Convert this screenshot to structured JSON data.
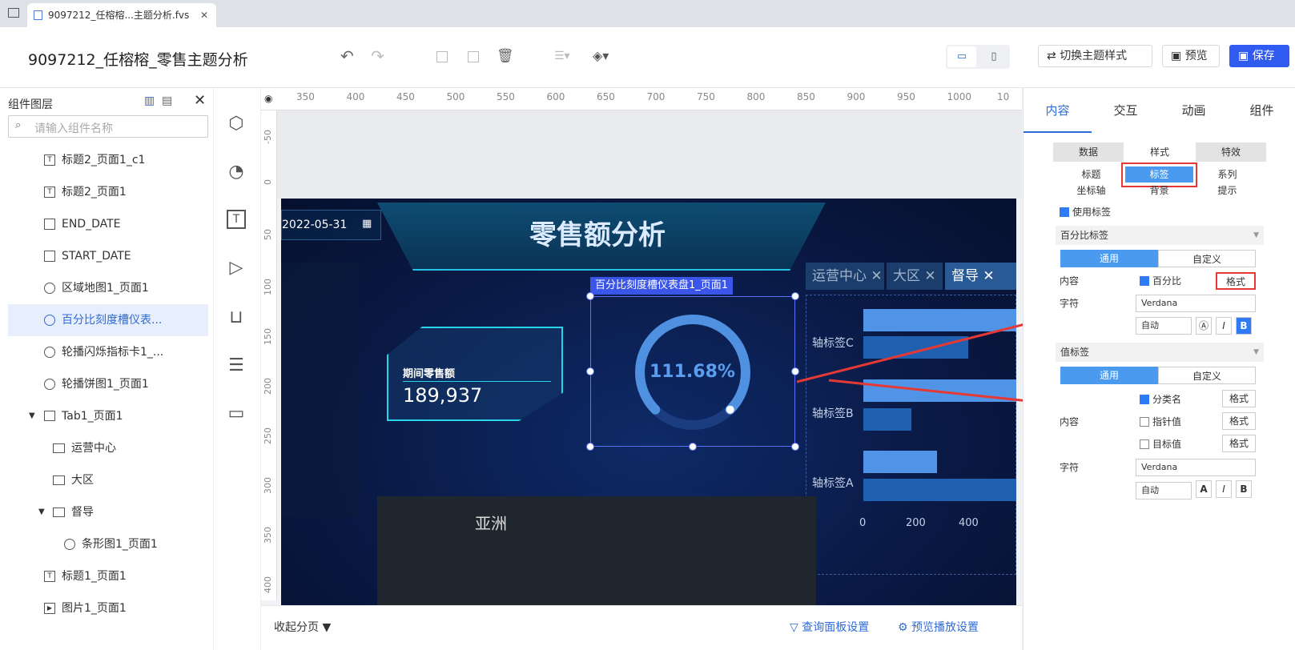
{
  "browser_tab": {
    "title": "9097212_任榕榕...主题分析.fvs",
    "close": "✕"
  },
  "header": {
    "title": "9097212_任榕榕_零售主题分析",
    "switch_theme": "切换主题样式",
    "preview": "预览",
    "save": "保存"
  },
  "left_panel": {
    "title": "组件图层",
    "search_placeholder": "请输入组件名称",
    "items": [
      {
        "label": "标题2_页面1_c1",
        "icon": "text-icon"
      },
      {
        "label": "标题2_页面1",
        "icon": "text-icon"
      },
      {
        "label": "END_DATE",
        "icon": "date-widget-icon"
      },
      {
        "label": "START_DATE",
        "icon": "date-widget-icon"
      },
      {
        "label": "区域地图1_页面1",
        "icon": "chart-icon"
      },
      {
        "label": "百分比刻度槽仪表...",
        "icon": "chart-icon"
      },
      {
        "label": "轮播闪烁指标卡1_...",
        "icon": "chart-icon"
      },
      {
        "label": "轮播饼图1_页面1",
        "icon": "chart-icon"
      },
      {
        "label": "Tab1_页面1",
        "icon": "tab-icon"
      },
      {
        "label": "运营中心",
        "icon": "folder-icon"
      },
      {
        "label": "大区",
        "icon": "folder-icon"
      },
      {
        "label": "督导",
        "icon": "folder-icon"
      },
      {
        "label": "条形图1_页面1",
        "icon": "chart-icon"
      },
      {
        "label": "标题1_页面1",
        "icon": "text-icon"
      },
      {
        "label": "图片1_页面1",
        "icon": "image-icon"
      }
    ]
  },
  "ruler": {
    "h": [
      "350",
      "400",
      "450",
      "500",
      "550",
      "600",
      "650",
      "700",
      "750",
      "800",
      "850",
      "900",
      "950",
      "1000",
      "10"
    ],
    "v": [
      "-50",
      "0",
      "50",
      "100",
      "150",
      "200",
      "250",
      "300",
      "350",
      "400"
    ]
  },
  "canvas": {
    "date": "2022-05-31",
    "title": "零售额分析",
    "kpi_label": "期间零售额",
    "kpi_value": "189,937",
    "gauge_label": "百分比刻度槽仪表盘1_页面1",
    "gauge_value": "111.68%",
    "gauge_percent": 111.68,
    "tabs": [
      "运营中心",
      "大区",
      "督导"
    ],
    "bar_labels": [
      "轴标签C",
      "轴标签B",
      "轴标签A"
    ],
    "axis_ticks": [
      "0",
      "200",
      "400"
    ],
    "map_label": "亚洲"
  },
  "right_panel": {
    "tabs": [
      "内容",
      "交互",
      "动画",
      "组件"
    ],
    "sub_tabs": [
      "数据",
      "样式",
      "特效"
    ],
    "style_tabs": [
      "标题",
      "标签",
      "系列",
      "坐标轴",
      "背景",
      "提示"
    ],
    "use_label": "使用标签",
    "percent_label_section": "百分比标签",
    "normal": "通用",
    "custom": "自定义",
    "content": "内容",
    "percent": "百分比",
    "format": "格式",
    "font": "字符",
    "font_name": "Verdana",
    "auto": "自动",
    "value_label_section": "值标签",
    "category_name": "分类名",
    "pointer_value": "指针值",
    "target_value": "目标值"
  },
  "bottom": {
    "collapse": "收起分页",
    "query_settings": "查询面板设置",
    "preview_settings": "预览播放设置"
  }
}
